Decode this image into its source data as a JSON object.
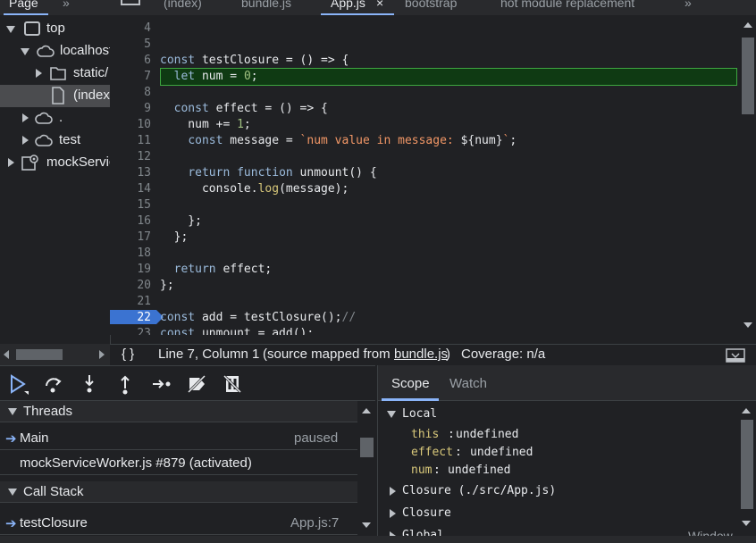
{
  "left_tabs": {
    "page": "Page",
    "more": "»"
  },
  "editor_tabs": [
    {
      "label": "(index)",
      "active": false
    },
    {
      "label": "bundle.js",
      "active": false
    },
    {
      "label": "App.js",
      "active": true,
      "close": "×"
    },
    {
      "label": "bootstrap",
      "active": false
    },
    {
      "label": "hot module replacement",
      "active": false
    }
  ],
  "editor_tabs_more": "»",
  "tree": {
    "items": [
      {
        "label": "top",
        "expanded": true,
        "icon": "frame-icon"
      },
      {
        "label": "localhost",
        "expanded": true,
        "icon": "cloud-icon"
      },
      {
        "label": "static/",
        "expanded": false,
        "icon": "folder-icon"
      },
      {
        "label": "(index)",
        "selected": true,
        "icon": "file-icon"
      },
      {
        "label": ".",
        "expanded": false,
        "icon": "cloud-icon"
      },
      {
        "label": "test",
        "expanded": false,
        "icon": "cloud-icon"
      },
      {
        "label": "mockServiceWorker",
        "expanded": false,
        "icon": "gear-icon"
      }
    ]
  },
  "code": {
    "line_numbers": [
      "4",
      "5",
      "6",
      "7",
      "8",
      "9",
      "10",
      "11",
      "12",
      "13",
      "14",
      "15",
      "16",
      "17",
      "18",
      "19",
      "20",
      "21",
      "22",
      "23"
    ],
    "current_line": "7",
    "breakpoint_line": "22"
  },
  "status": {
    "braces": "{ }",
    "position": "Line 7, Column 1",
    "mapped_prefix": "(source mapped from ",
    "mapped_file": "bundle.js",
    "mapped_suffix": ")",
    "coverage": "Coverage: n/a"
  },
  "threads": {
    "title": "Threads",
    "items": [
      {
        "name": "Main",
        "status": "paused",
        "current": true
      },
      {
        "name": "mockServiceWorker.js #879 (activated)",
        "status": "",
        "current": false
      }
    ]
  },
  "call_stack": {
    "title": "Call Stack",
    "items": [
      {
        "name": "testClosure",
        "location": "App.js:7",
        "current": true
      }
    ]
  },
  "scope": {
    "tabs": [
      "Scope",
      "Watch"
    ],
    "active_tab": "Scope",
    "local_title": "Local",
    "local_vars": [
      {
        "key": "this",
        "value": "undefined"
      },
      {
        "key": "effect",
        "value": "undefined"
      },
      {
        "key": "num",
        "value": "undefined"
      }
    ],
    "closures": [
      "Closure (./src/App.js)",
      "Closure",
      "Global"
    ],
    "global_value": "Window"
  },
  "colors": {
    "accent": "#8ab4f8",
    "current_line_bg": "#0f3a13",
    "current_line_border": "#3ea640",
    "breakpoint": "#3b73d1"
  }
}
